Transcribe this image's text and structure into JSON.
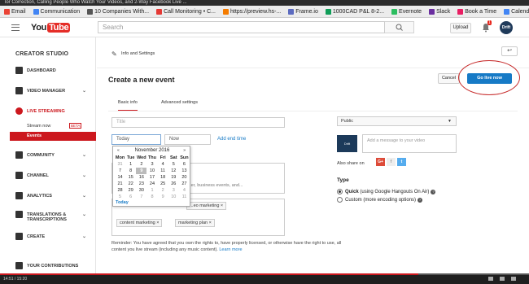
{
  "video_title": "lor Correction, Calling People Who Watch Your Videos, and 2-Way Facebook Live ...",
  "bookmarks": [
    {
      "label": "Email",
      "color": "#ea4335"
    },
    {
      "label": "Communication",
      "color": "#4285f4"
    },
    {
      "label": "10 Companies With...",
      "color": "#555555"
    },
    {
      "label": "Call Monitoring • C...",
      "color": "#e53935"
    },
    {
      "label": "https://preview.hs-...",
      "color": "#f57c00"
    },
    {
      "label": "Frame.io",
      "color": "#5c6bc0"
    },
    {
      "label": "1000CAD P&L 8-2...",
      "color": "#0f9d58"
    },
    {
      "label": "Evernote",
      "color": "#2dbe60"
    },
    {
      "label": "Slack",
      "color": "#6b2fa0"
    },
    {
      "label": "Book a Time",
      "color": "#e91e63"
    },
    {
      "label": "Calendar",
      "color": "#4285f4"
    }
  ],
  "header": {
    "logo_you": "You",
    "logo_tube": "Tube",
    "search_placeholder": "Search",
    "upload_label": "Upload",
    "notification_count": "1",
    "avatar_label": "Drift"
  },
  "sidebar": {
    "title": "CREATOR STUDIO",
    "items": [
      {
        "label": "DASHBOARD"
      },
      {
        "label": "VIDEO MANAGER"
      },
      {
        "label": "LIVE STREAMING"
      },
      {
        "label": "COMMUNITY"
      },
      {
        "label": "CHANNEL"
      },
      {
        "label": "ANALYTICS"
      },
      {
        "label": "TRANSLATIONS &"
      },
      {
        "label": "CREATE"
      },
      {
        "label": "YOUR CONTRIBUTIONS"
      }
    ],
    "translations_line2": "TRANSCRIPTIONS",
    "sub_stream_now": "Stream now",
    "beta_badge": "BETA",
    "sub_events": "Events"
  },
  "main": {
    "breadcrumb": "Info and Settings",
    "page_title": "Create a new event",
    "cancel_label": "Cancel",
    "golive_label": "Go live now",
    "tabs": [
      {
        "label": "Basic info"
      },
      {
        "label": "Advanced settings"
      }
    ],
    "title_placeholder": "Title",
    "date_value": "Today",
    "time_value": "Now",
    "add_end_time": "Add end time",
    "description_fragment": "...er, business events, and...",
    "tags": [
      "...eo marketing",
      "content marketing",
      "marketing plan"
    ],
    "calendar": {
      "month_label": "November 2016",
      "prev": "«",
      "next": "»",
      "dow": [
        "Mon",
        "Tue",
        "Wed",
        "Thu",
        "Fri",
        "Sat",
        "Sun"
      ],
      "days": [
        "31",
        "1",
        "2",
        "3",
        "4",
        "5",
        "6",
        "7",
        "8",
        "9",
        "10",
        "11",
        "12",
        "13",
        "14",
        "15",
        "16",
        "17",
        "18",
        "19",
        "20",
        "21",
        "22",
        "23",
        "24",
        "25",
        "26",
        "27",
        "28",
        "29",
        "30",
        "1",
        "2",
        "3",
        "4",
        "5",
        "6",
        "7",
        "8",
        "9",
        "10",
        "11"
      ],
      "selected_day": "9",
      "today_label": "Today"
    },
    "privacy_value": "Public",
    "message_placeholder": "Add a message to your video",
    "also_share_label": "Also share on",
    "type_heading": "Type",
    "type_quick_label": "Quick",
    "type_quick_desc": "(using Google Hangouts On Air)",
    "type_custom_label": "Custom",
    "type_custom_desc": "(more encoding options)",
    "reminder_text": "Reminder: You have agreed that you own the rights to, have properly licensed, or otherwise have the right to use, all content you live stream (including any music content).",
    "learn_more": "Learn more"
  },
  "player": {
    "time_display": "14:51 / 15:20",
    "progress_fraction": 0.79
  }
}
